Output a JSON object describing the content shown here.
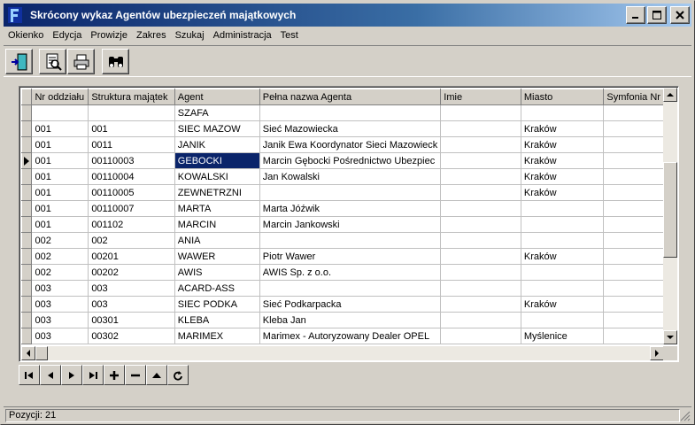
{
  "window": {
    "title": "Skrócony wykaz Agentów ubezpieczeń majątkowych",
    "app_icon": "app-logo-icon",
    "minimize_glyph": "_",
    "close_glyph": "✕"
  },
  "menu": [
    "Okienko",
    "Edycja",
    "Prowizje",
    "Zakres",
    "Szukaj",
    "Administracja",
    "Test"
  ],
  "toolbar": {
    "icons": [
      "exit-door-icon",
      "preview-document-icon",
      "printer-icon",
      "binoculars-search-icon"
    ]
  },
  "grid": {
    "columns": [
      "Nr oddziału",
      "Struktura majątek",
      "Agent",
      "Pełna nazwa Agenta",
      "Imie",
      "Miasto",
      "Symfonia Nr"
    ],
    "selected_row": 3,
    "selected_col": 2,
    "rows": [
      [
        "",
        "",
        "SZAFA",
        "",
        "",
        "",
        ""
      ],
      [
        "001",
        "001",
        "SIEC MAZOW",
        "Sieć Mazowiecka",
        "",
        "Kraków",
        ""
      ],
      [
        "001",
        "0011",
        "JANIK",
        "Janik Ewa Koordynator Sieci Mazowieck",
        "",
        "Kraków",
        ""
      ],
      [
        "001",
        "00110003",
        "GEBOCKI",
        "Marcin Gębocki Pośrednictwo Ubezpiec",
        "",
        "Kraków",
        ""
      ],
      [
        "001",
        "00110004",
        "KOWALSKI",
        "Jan Kowalski",
        "",
        "Kraków",
        ""
      ],
      [
        "001",
        "00110005",
        "ZEWNETRZNI",
        "",
        "",
        "Kraków",
        ""
      ],
      [
        "001",
        "00110007",
        "MARTA",
        "Marta Jóźwik",
        "",
        "",
        ""
      ],
      [
        "001",
        "001102",
        "MARCIN",
        "Marcin Jankowski",
        "",
        "",
        ""
      ],
      [
        "002",
        "002",
        "ANIA",
        "",
        "",
        "",
        ""
      ],
      [
        "002",
        "00201",
        "WAWER",
        "Piotr Wawer",
        "",
        "Kraków",
        ""
      ],
      [
        "002",
        "00202",
        "AWIS",
        "AWIS Sp. z o.o.",
        "",
        "",
        ""
      ],
      [
        "003",
        "003",
        "ACARD-ASS",
        "",
        "",
        "",
        ""
      ],
      [
        "003",
        "003",
        "SIEC PODKA",
        "Sieć Podkarpacka",
        "",
        "Kraków",
        ""
      ],
      [
        "003",
        "00301",
        "KLEBA",
        "Kleba Jan",
        "",
        "",
        ""
      ],
      [
        "003",
        "00302",
        "MARIMEX",
        "Marimex - Autoryzowany  Dealer OPEL",
        "",
        "Myślenice",
        ""
      ]
    ]
  },
  "navigator": {
    "buttons": [
      "first-record-icon",
      "prior-record-icon",
      "next-record-icon",
      "last-record-icon",
      "insert-record-icon",
      "delete-record-icon",
      "edit-record-icon",
      "refresh-icon"
    ]
  },
  "status": {
    "text": "Pozycji: 21"
  }
}
